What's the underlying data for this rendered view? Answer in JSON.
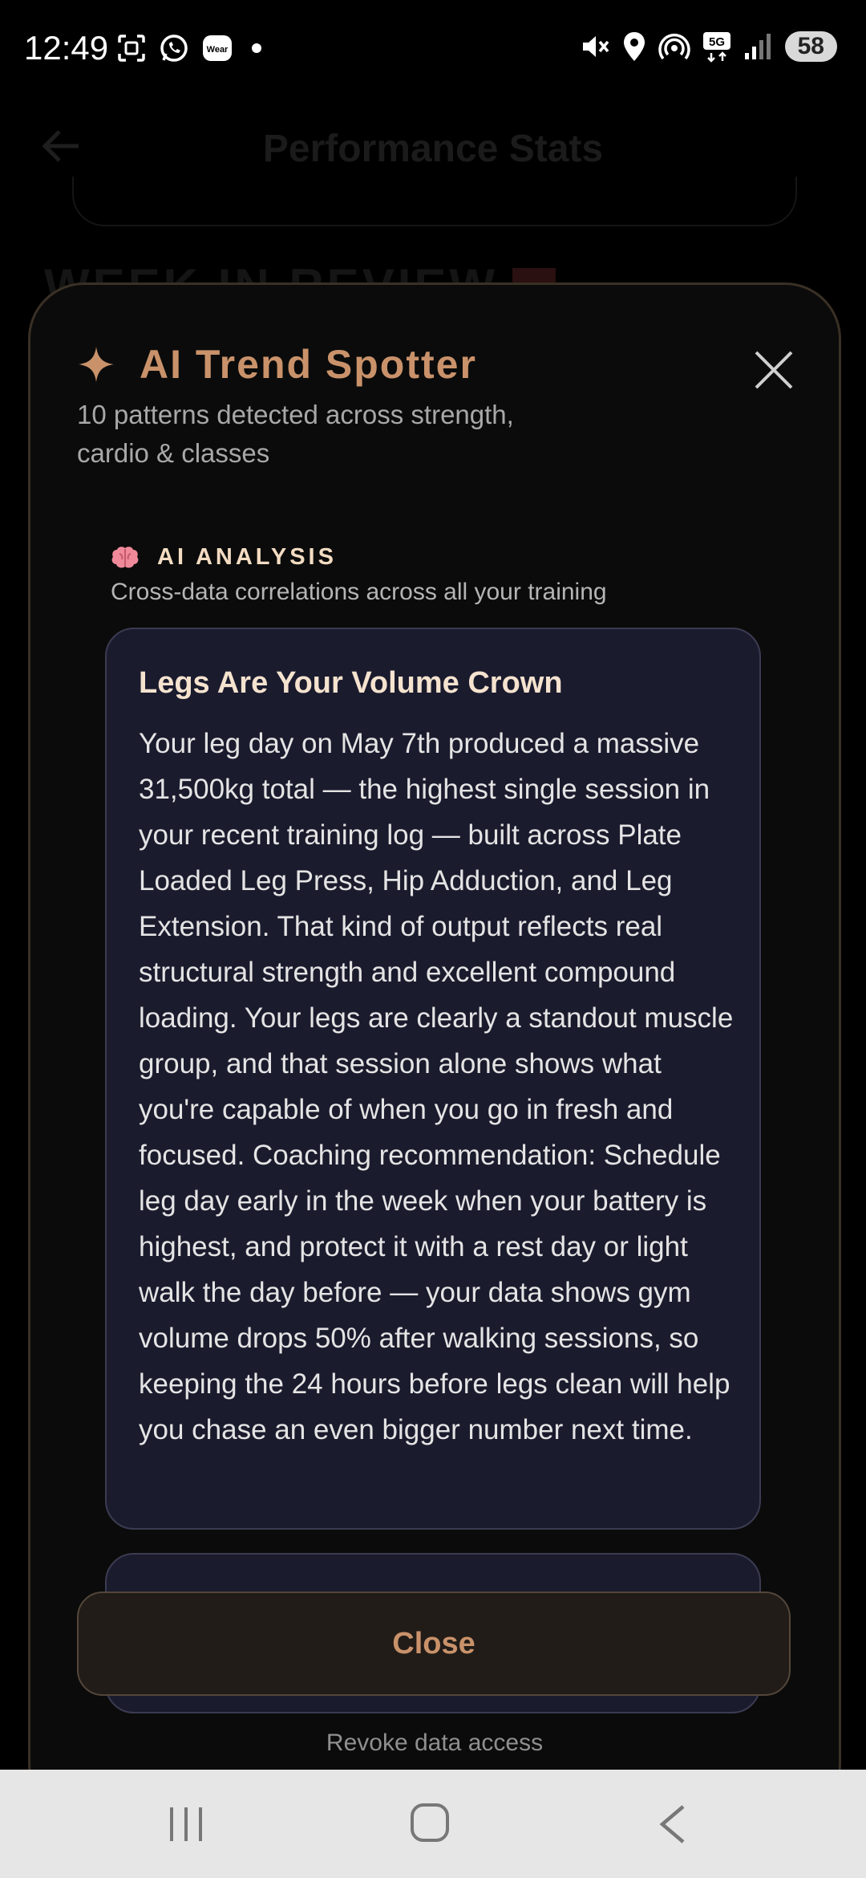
{
  "status_bar": {
    "time": "12:49",
    "left_icons": [
      "screenshot-icon",
      "whatsapp-icon",
      "wear-icon",
      "dot-icon"
    ],
    "wear_label": "Wear",
    "right_icons": [
      "mute-icon",
      "location-icon",
      "hotspot-icon",
      "5g-icon",
      "signal-icon"
    ],
    "network": "5G",
    "battery": "58"
  },
  "page": {
    "title": "Performance Stats",
    "section_heading": "WEEK IN REVIEW"
  },
  "sheet": {
    "title": "AI Trend Spotter",
    "subtitle": "10 patterns detected across strength, cardio & classes",
    "analysis": {
      "label": "AI ANALYSIS",
      "subtitle": "Cross-data correlations across all your training"
    },
    "insights": [
      {
        "title": "Legs Are Your Volume Crown",
        "body": "Your leg day on May 7th produced a massive 31,500kg total — the highest single session in your recent training log — built across Plate Loaded Leg Press, Hip Adduction, and Leg Extension. That kind of output reflects real structural strength and excellent compound loading. Your legs are clearly a standout muscle group, and that session alone shows what you're capable of when you go in fresh and focused. Coaching recommendation: Schedule leg day early in the week when your battery is highest, and protect it with a rest day or light walk the day before — your data shows gym volume drops 50% after walking sessions, so keeping the 24 hours before legs clean will help you chase an even bigger number next time."
      }
    ],
    "close_label": "Close",
    "revoke_label": "Revoke data access"
  },
  "colors": {
    "accent": "#c9926a",
    "card_bg": "#1b1b2e",
    "sheet_bg": "#0b0b0b"
  }
}
